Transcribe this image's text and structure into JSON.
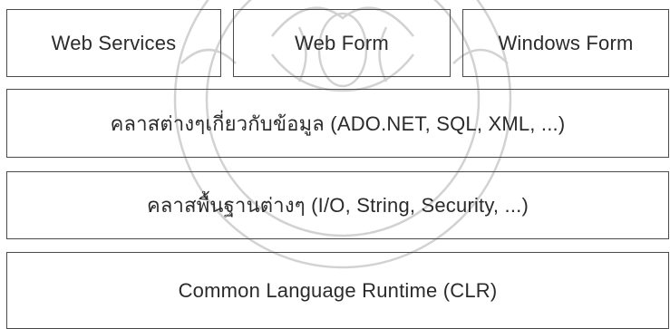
{
  "diagram": {
    "top_row": [
      {
        "label": "Web Services"
      },
      {
        "label": "Web Form"
      },
      {
        "label": "Windows Form"
      }
    ],
    "layers": [
      {
        "label": "คลาสต่างๆเกี่ยวกับข้อมูล  (ADO.NET, SQL, XML, ...)"
      },
      {
        "label": "คลาสพื้นฐานต่างๆ  (I/O, String, Security, ...)"
      },
      {
        "label": "Common Language Runtime (CLR)"
      }
    ]
  },
  "colors": {
    "border": "#4a4a4a",
    "text": "#2b2b2b",
    "watermark": "#cfcfcf"
  },
  "watermark": {
    "motif": "university-seal-icon"
  }
}
